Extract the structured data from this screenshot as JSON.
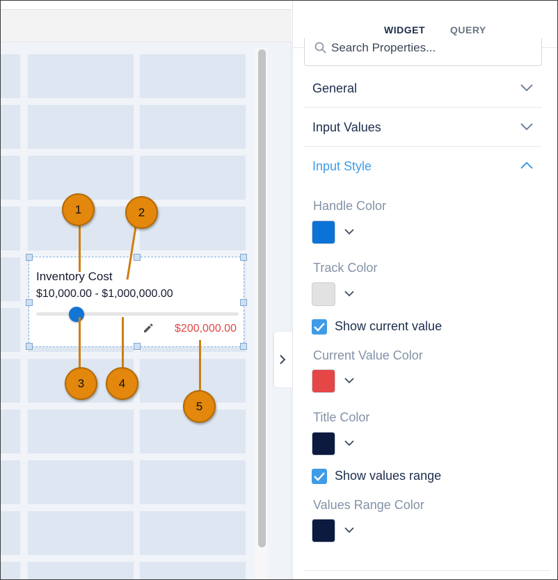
{
  "tabs": [
    {
      "label": "WIDGET",
      "active": true
    },
    {
      "label": "QUERY",
      "active": false
    }
  ],
  "search": {
    "placeholder": "Search Properties..."
  },
  "sections": [
    {
      "label": "General",
      "state": "collapsed"
    },
    {
      "label": "Input Values",
      "state": "collapsed"
    },
    {
      "label": "Input Style",
      "state": "expanded"
    }
  ],
  "input_style": {
    "handle_color": {
      "label": "Handle Color",
      "color": "#0b72d6"
    },
    "track_color": {
      "label": "Track Color",
      "color": "#e2e2e2"
    },
    "show_current_value": {
      "label": "Show current value",
      "checked": true
    },
    "current_value_color": {
      "label": "Current Value Color",
      "color": "#e54646"
    },
    "title_color": {
      "label": "Title Color",
      "color": "#0c1a3f"
    },
    "show_values_range": {
      "label": "Show values range",
      "checked": true
    },
    "values_range_color": {
      "label": "Values Range Color",
      "color": "#0c1a3f"
    }
  },
  "widget": {
    "title": "Inventory Cost",
    "range": "$10,000.00 - $1,000,000.00",
    "current_value": "$200,000.00",
    "slider_fraction": 0.2
  },
  "callouts": [
    "1",
    "2",
    "3",
    "4",
    "5"
  ],
  "colors": {
    "accent_blue": "#3f9be6",
    "callout_orange": "#e3870d",
    "navy": "#1b2d4b"
  },
  "icons": {
    "search": "search-icon",
    "chevron_down": "chevron-down-icon",
    "chevron_up": "chevron-up-icon",
    "chevron_right": "chevron-right-icon",
    "edit": "pencil-icon",
    "check": "check-icon"
  }
}
